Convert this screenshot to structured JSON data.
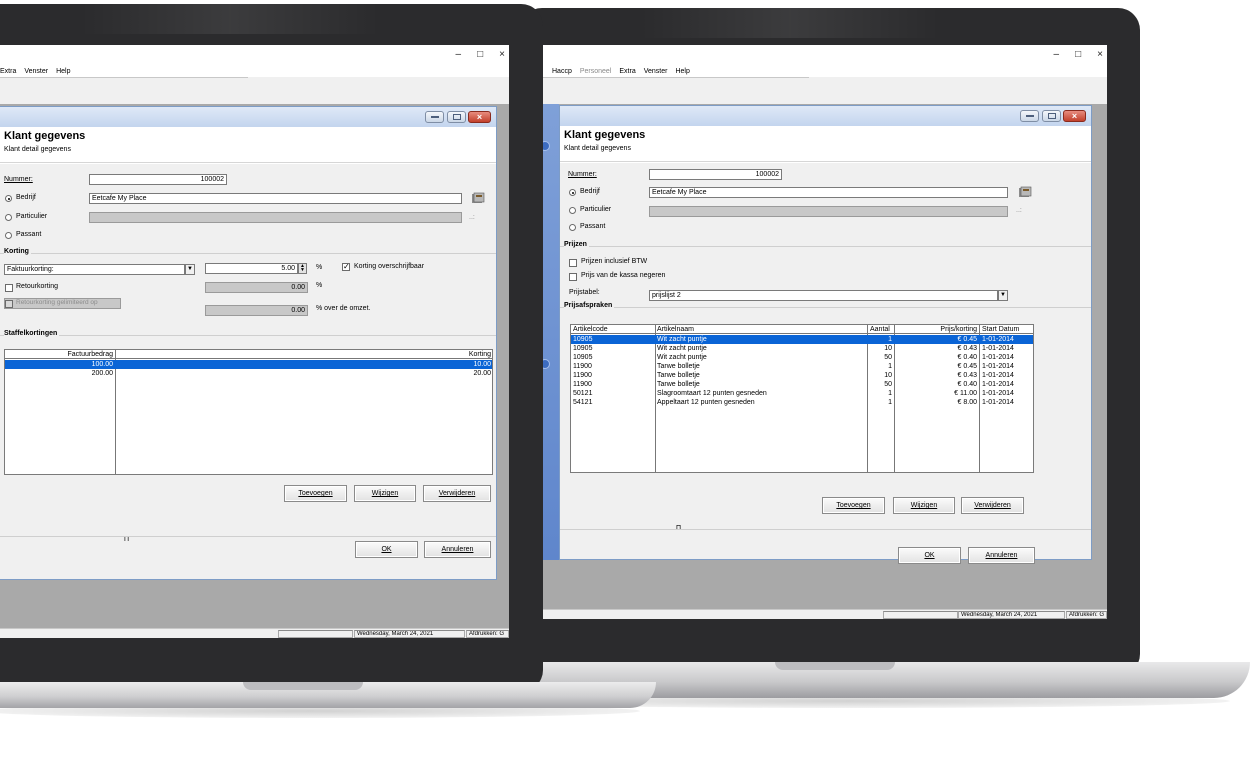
{
  "window_controls": {
    "minimize": "–",
    "maximize": "□",
    "close": "×"
  },
  "back_window": {
    "menu": [
      "Haccp",
      "Personeel",
      "Extra",
      "Venster",
      "Help"
    ],
    "menu_disabled": [
      false,
      true,
      false,
      false,
      false
    ],
    "form": {
      "title": "Klant gegevens",
      "subtitle": "Klant detail gegevens",
      "nummer_label": "Nummer:",
      "nummer_value": "100002",
      "type_options": [
        "Bedrijf",
        "Particulier",
        "Passant"
      ],
      "type_selected": "Bedrijf",
      "bedrijf_value": "Eetcafe My Place",
      "particulier_value": "",
      "prijzen_section": "Prijzen",
      "prijzen_incl_btw": "Prijzen inclusief BTW",
      "prijzen_incl_btw_checked": false,
      "prijs_kassa_negeren": "Prijs van de kassa negeren",
      "prijs_kassa_negeren_checked": false,
      "prijstabel_label": "Prijstabel:",
      "prijstabel_value": "prijslijst 2",
      "prijsafspraken_section": "Prijsafspraken",
      "table": {
        "columns": [
          "Artikelcode",
          "Artikelnaam",
          "Aantal",
          "Prijs/korting",
          "Start Datum"
        ],
        "rows": [
          [
            "10905",
            "Wit zacht puntje",
            "1",
            "€ 0.45",
            "1-01-2014"
          ],
          [
            "10905",
            "Wit zacht puntje",
            "10",
            "€ 0.43",
            "1-01-2014"
          ],
          [
            "10905",
            "Wit zacht puntje",
            "50",
            "€ 0.40",
            "1-01-2014"
          ],
          [
            "11900",
            "Tarwe bolletje",
            "1",
            "€ 0.45",
            "1-01-2014"
          ],
          [
            "11900",
            "Tarwe bolletje",
            "10",
            "€ 0.43",
            "1-01-2014"
          ],
          [
            "11900",
            "Tarwe bolletje",
            "50",
            "€ 0.40",
            "1-01-2014"
          ],
          [
            "50121",
            "Slagroomtaart 12 punten gesneden",
            "1",
            "€ 11.00",
            "1-01-2014"
          ],
          [
            "54121",
            "Appeltaart 12 punten gesneden",
            "1",
            "€ 8.00",
            "1-01-2014"
          ]
        ],
        "selected_row": 0
      },
      "buttons": {
        "add": "Toevoegen",
        "edit": "Wijzigen",
        "delete": "Verwijderen",
        "ok": "OK",
        "cancel": "Annuleren"
      },
      "divider_mark": "Π"
    },
    "status": {
      "date": "Wednesday, March 24, 2021",
      "print": "Afdrukken: G"
    }
  },
  "front_window": {
    "menu": [
      "Extra",
      "Venster",
      "Help"
    ],
    "form": {
      "title": "Klant gegevens",
      "subtitle": "Klant detail gegevens",
      "nummer_label": "Nummer:",
      "nummer_value": "100002",
      "type_options": [
        "Bedrijf",
        "Particulier",
        "Passant"
      ],
      "type_selected": "Bedrijf",
      "bedrijf_value": "Eetcafe My Place",
      "particulier_value": "",
      "korting_section": "Korting",
      "korting_type": "Faktuurkorting:",
      "korting_value": "5.00",
      "percent": "%",
      "korting_overschrijfbaar": "Korting overschrijfbaar",
      "korting_overschrijfbaar_checked": true,
      "retourkorting": "Retourkorting",
      "retourkorting_checked": false,
      "retourkorting_value": "0.00",
      "retour_gelimiteerd": "Retourkorting gelimiteerd op",
      "retour_gelimiteerd_checked": false,
      "omzet_value": "0.00",
      "omzet_suffix": "% over de omzet.",
      "staffel_section": "Staffelkortingen",
      "staffel_table": {
        "columns": [
          "Factuurbedrag",
          "Korting"
        ],
        "rows": [
          [
            "100.00",
            "10.00"
          ],
          [
            "200.00",
            "20.00"
          ]
        ],
        "selected_row": 0
      },
      "buttons": {
        "add": "Toevoegen",
        "edit": "Wijzigen",
        "delete": "Verwijderen",
        "ok": "OK",
        "cancel": "Annuleren"
      },
      "divider_mark": "Π"
    },
    "status": {
      "date": "Wednesday, March 24, 2021",
      "print": "Afdrukken: G"
    }
  },
  "colors": {
    "selection": "#0a64d6",
    "mdi_background": "#a9a9a9",
    "child_title": "#c3d5ee",
    "close_button": "#c2402c",
    "bezel": "#2b2b2d"
  }
}
